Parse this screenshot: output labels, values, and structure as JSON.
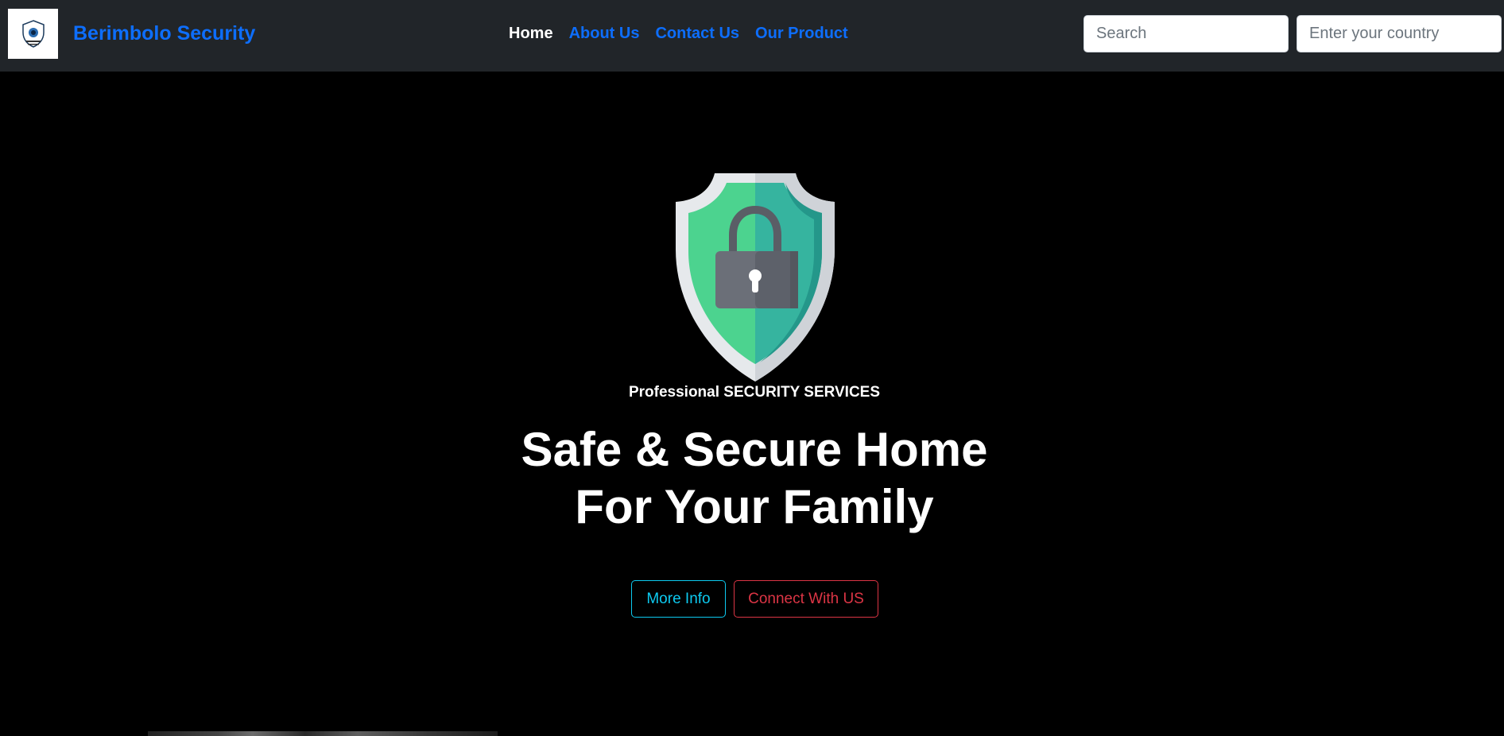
{
  "navbar": {
    "brand": "Berimbolo Security",
    "logo_icon": "shield-logo-icon",
    "links": [
      {
        "label": "Home",
        "active": true
      },
      {
        "label": "About Us",
        "active": false
      },
      {
        "label": "Contact Us",
        "active": false
      },
      {
        "label": "Our Product",
        "active": false
      }
    ],
    "search_placeholder": "Search",
    "country_placeholder": "Enter your country"
  },
  "hero": {
    "icon": "shield-lock-icon",
    "tagline": "Professional SECURITY SERVICES",
    "headline_line1": "Safe & Secure Home",
    "headline_line2": "For Your Family",
    "more_info_label": "More Info",
    "connect_label": "Connect With US"
  },
  "colors": {
    "navbar_bg": "#212529",
    "link": "#0d6efd",
    "info": "#0dcaf0",
    "danger": "#dc3545",
    "shield_green": "#4cd38f",
    "shield_teal": "#36b49f"
  }
}
